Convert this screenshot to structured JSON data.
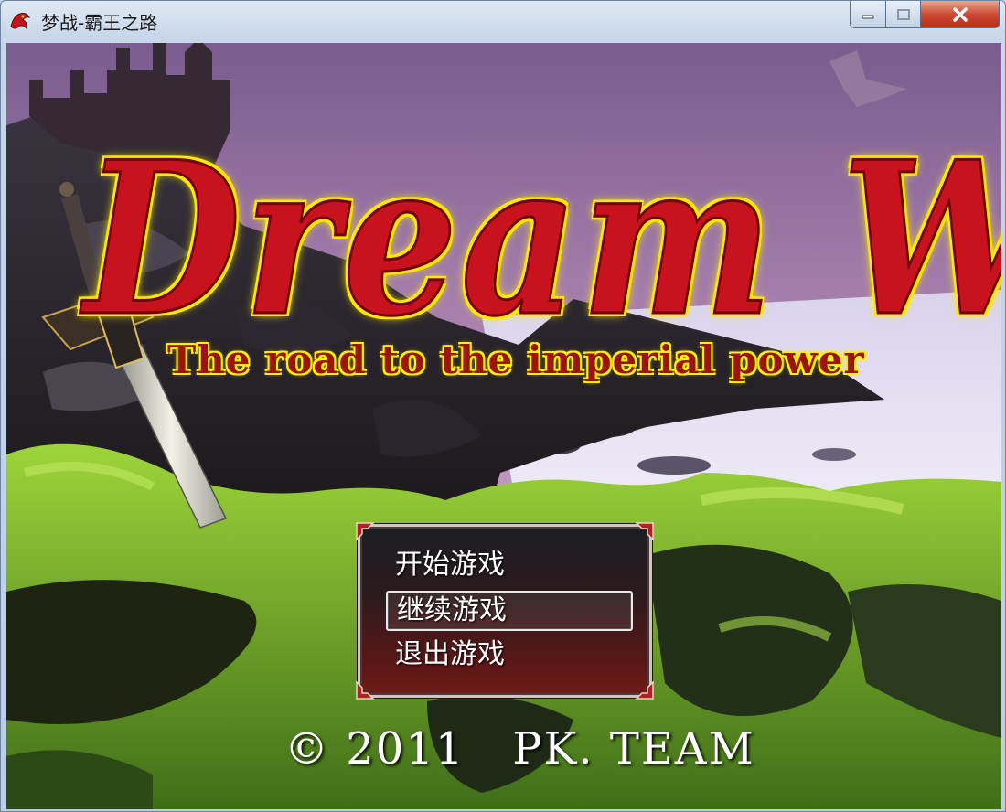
{
  "window": {
    "title": "梦战-霸王之路",
    "icon": "dragon-app-icon",
    "buttons": {
      "minimize": "minimize-icon",
      "maximize": "maximize-icon",
      "close": "close-icon"
    }
  },
  "logo": {
    "main": "Dream War",
    "subtitle": "The road to the imperial power"
  },
  "menu": {
    "items": [
      {
        "label": "开始游戏",
        "selected": false
      },
      {
        "label": "继续游戏",
        "selected": true
      },
      {
        "label": "退出游戏",
        "selected": false
      }
    ]
  },
  "footer": {
    "copyright": "© 2011   PK. TEAM"
  },
  "colors": {
    "logo_fill": "#c8121e",
    "logo_glow": "#ffe600",
    "menu_bg": "#5a1717",
    "close_button": "#cf4b33"
  }
}
